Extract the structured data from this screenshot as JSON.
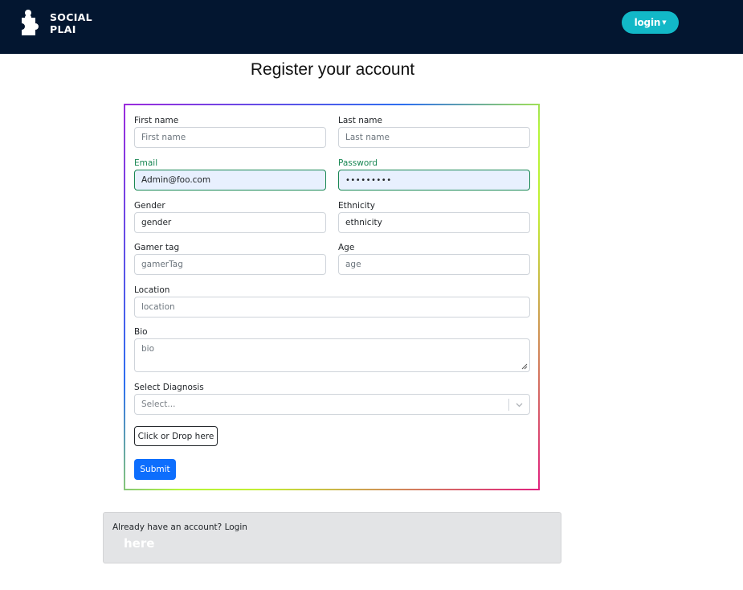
{
  "navbar": {
    "brand_line1": "SOCIAL",
    "brand_line2": "PLAI",
    "logo_icon": "puzzle-piece-icon",
    "login_button": "login",
    "caret_icon": "caret-down-icon"
  },
  "page": {
    "title": "Register your account"
  },
  "form": {
    "first_name": {
      "label": "First name",
      "placeholder": "First name",
      "value": ""
    },
    "last_name": {
      "label": "Last name",
      "placeholder": "Last name",
      "value": ""
    },
    "email": {
      "label": "Email",
      "value": "Admin@foo.com"
    },
    "password": {
      "label": "Password",
      "value": "•••••••••"
    },
    "gender": {
      "label": "Gender",
      "value": "gender"
    },
    "ethnicity": {
      "label": "Ethnicity",
      "value": "ethnicity"
    },
    "gamer_tag": {
      "label": "Gamer tag",
      "placeholder": "gamerTag"
    },
    "age": {
      "label": "Age",
      "placeholder": "age"
    },
    "location": {
      "label": "Location",
      "placeholder": "location"
    },
    "bio": {
      "label": "Bio",
      "placeholder": "bio"
    },
    "diagnosis": {
      "label": "Select Diagnosis",
      "selected": "Select..."
    },
    "upload_button": "Click or Drop here",
    "submit_button": "Submit"
  },
  "footer": {
    "prompt": "Already have an account? Login",
    "link": "here"
  },
  "colors": {
    "navbar_bg": "#031630",
    "login_pill": "#12b8c7",
    "submit": "#0d6efd",
    "valid_border": "#198754"
  }
}
